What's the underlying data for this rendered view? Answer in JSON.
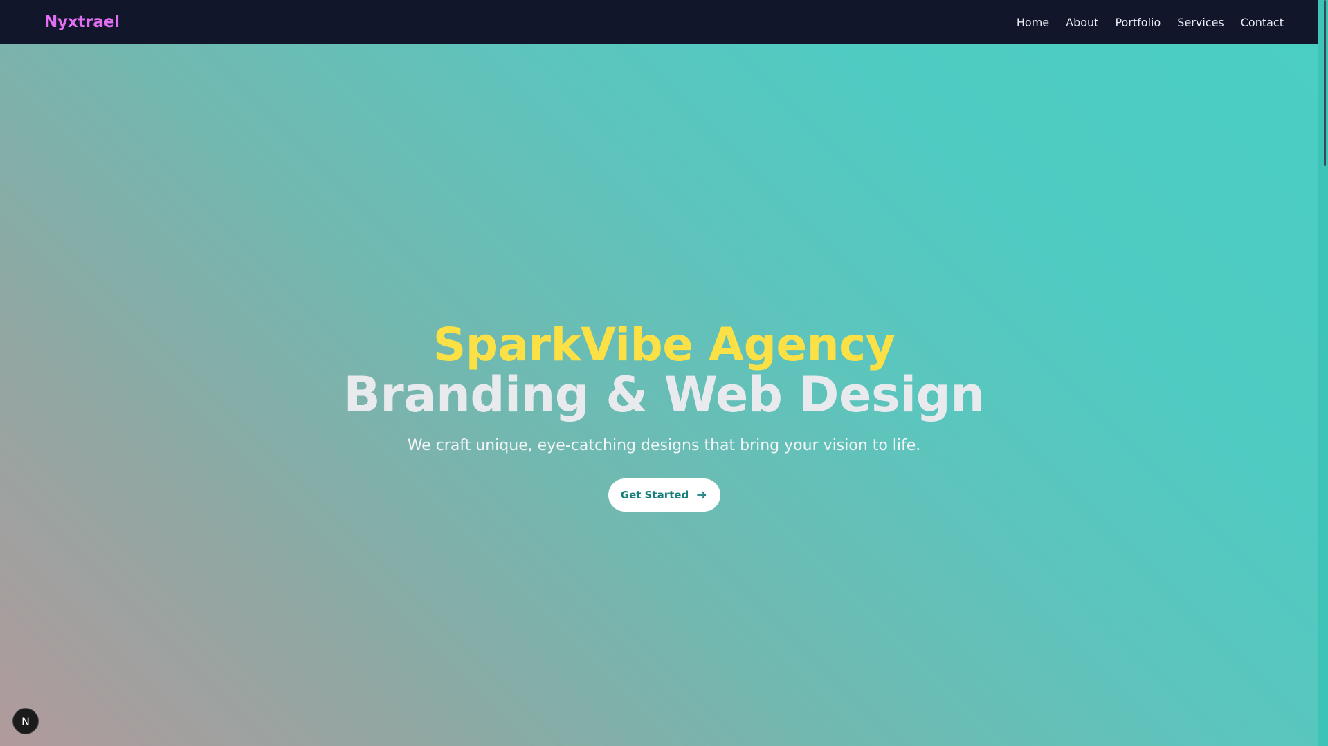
{
  "navbar": {
    "brand": "Nyxtrael",
    "links": [
      "Home",
      "About",
      "Portfolio",
      "Services",
      "Contact"
    ]
  },
  "hero": {
    "title_line1": "SparkVibe Agency",
    "title_line2": "Branding & Web Design",
    "subtitle": "We craft unique, eye-catching designs that bring your vision to life.",
    "cta_label": "Get Started",
    "cta_icon": "arrow-right-icon"
  },
  "dev_badge": {
    "letter": "N"
  },
  "colors": {
    "navbar_bg": "#12162a",
    "brand": "#e26ef2",
    "title_accent": "#fbe046",
    "title_main": "#e8eaee",
    "cta_text": "#157f7d",
    "gradient_start": "#b19a9c",
    "gradient_end": "#4acec4"
  }
}
